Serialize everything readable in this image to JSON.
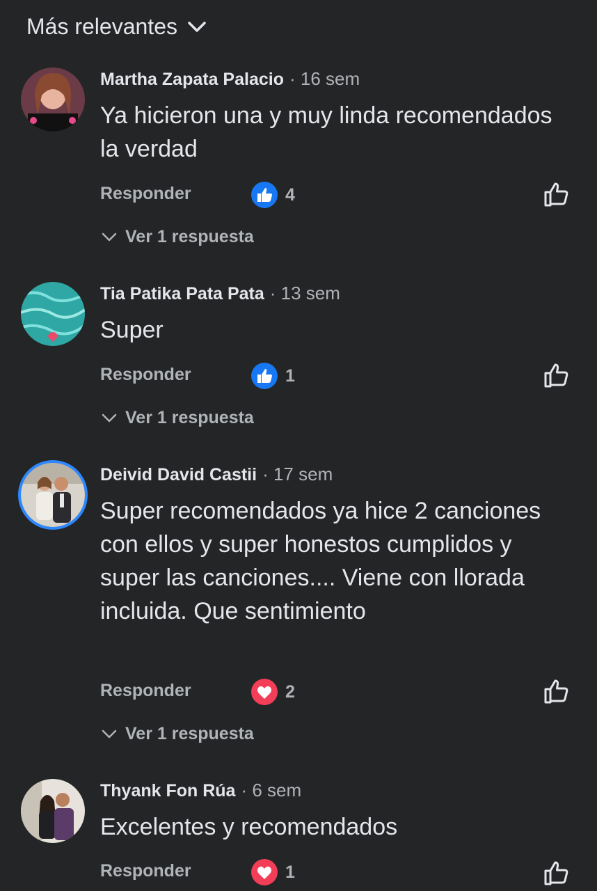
{
  "sort": {
    "label": "Más relevantes"
  },
  "comments": [
    {
      "author": "Martha Zapata Palacio",
      "time": "· 16 sem",
      "text": "Ya hicieron una y muy linda recomendados la verdad",
      "reply_label": "Responder",
      "reaction": {
        "type": "like",
        "count": "4"
      },
      "view_replies": "Ver 1 respuesta"
    },
    {
      "author": "Tia Patika Pata Pata",
      "time": "· 13 sem",
      "text": "Super",
      "reply_label": "Responder",
      "reaction": {
        "type": "like",
        "count": "1"
      },
      "view_replies": "Ver 1 respuesta"
    },
    {
      "author": "Deivid David Castii",
      "time": "· 17 sem",
      "text": "Super recomendados ya hice 2 canciones con ellos y super honestos cumplidos y super las canciones.... Viene con llorada incluida. Que sentimiento",
      "reply_label": "Responder",
      "reaction": {
        "type": "love",
        "count": "2"
      },
      "view_replies": "Ver 1 respuesta"
    },
    {
      "author": "Thyank Fon Rúa",
      "time": "· 6 sem",
      "text": "Excelentes y recomendados",
      "reply_label": "Responder",
      "reaction": {
        "type": "love",
        "count": "1"
      }
    }
  ],
  "colors": {
    "background": "#242526",
    "primary_text": "#e4e6eb",
    "secondary_text": "#b0b3b8",
    "like_blue": "#1877f2",
    "love_red": "#f33e58"
  }
}
